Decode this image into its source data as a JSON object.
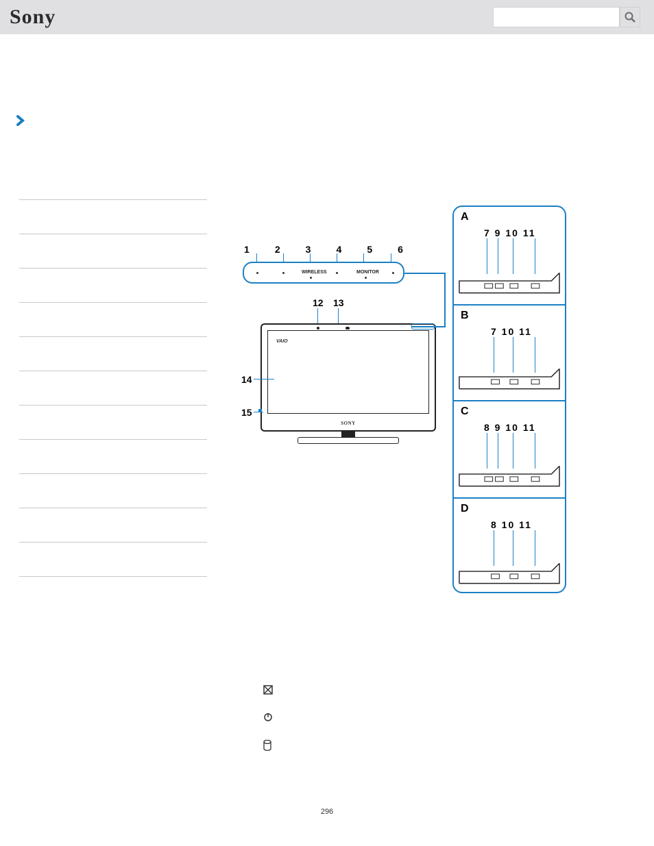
{
  "header": {
    "brand": "Sony",
    "search_placeholder": ""
  },
  "page_number": "296",
  "top_numbers": [
    "1",
    "2",
    "3",
    "4",
    "5",
    "6"
  ],
  "cam_numbers": [
    "12",
    "13"
  ],
  "side_numbers": {
    "n14": "14",
    "n15": "15"
  },
  "band_labels": {
    "wireless": "WIRELESS",
    "monitor": "MONITOR"
  },
  "monitor_labels": {
    "vaio": "VAIO",
    "sony": "SONY"
  },
  "details": [
    {
      "letter": "A",
      "nums": "7 9 10  11",
      "buttons": 4
    },
    {
      "letter": "B",
      "nums": "7 10  11",
      "buttons": 3
    },
    {
      "letter": "C",
      "nums": "8 9 10  11",
      "buttons": 4
    },
    {
      "letter": "D",
      "nums": "8 10  11",
      "buttons": 3
    }
  ],
  "nav_item_count": 12
}
